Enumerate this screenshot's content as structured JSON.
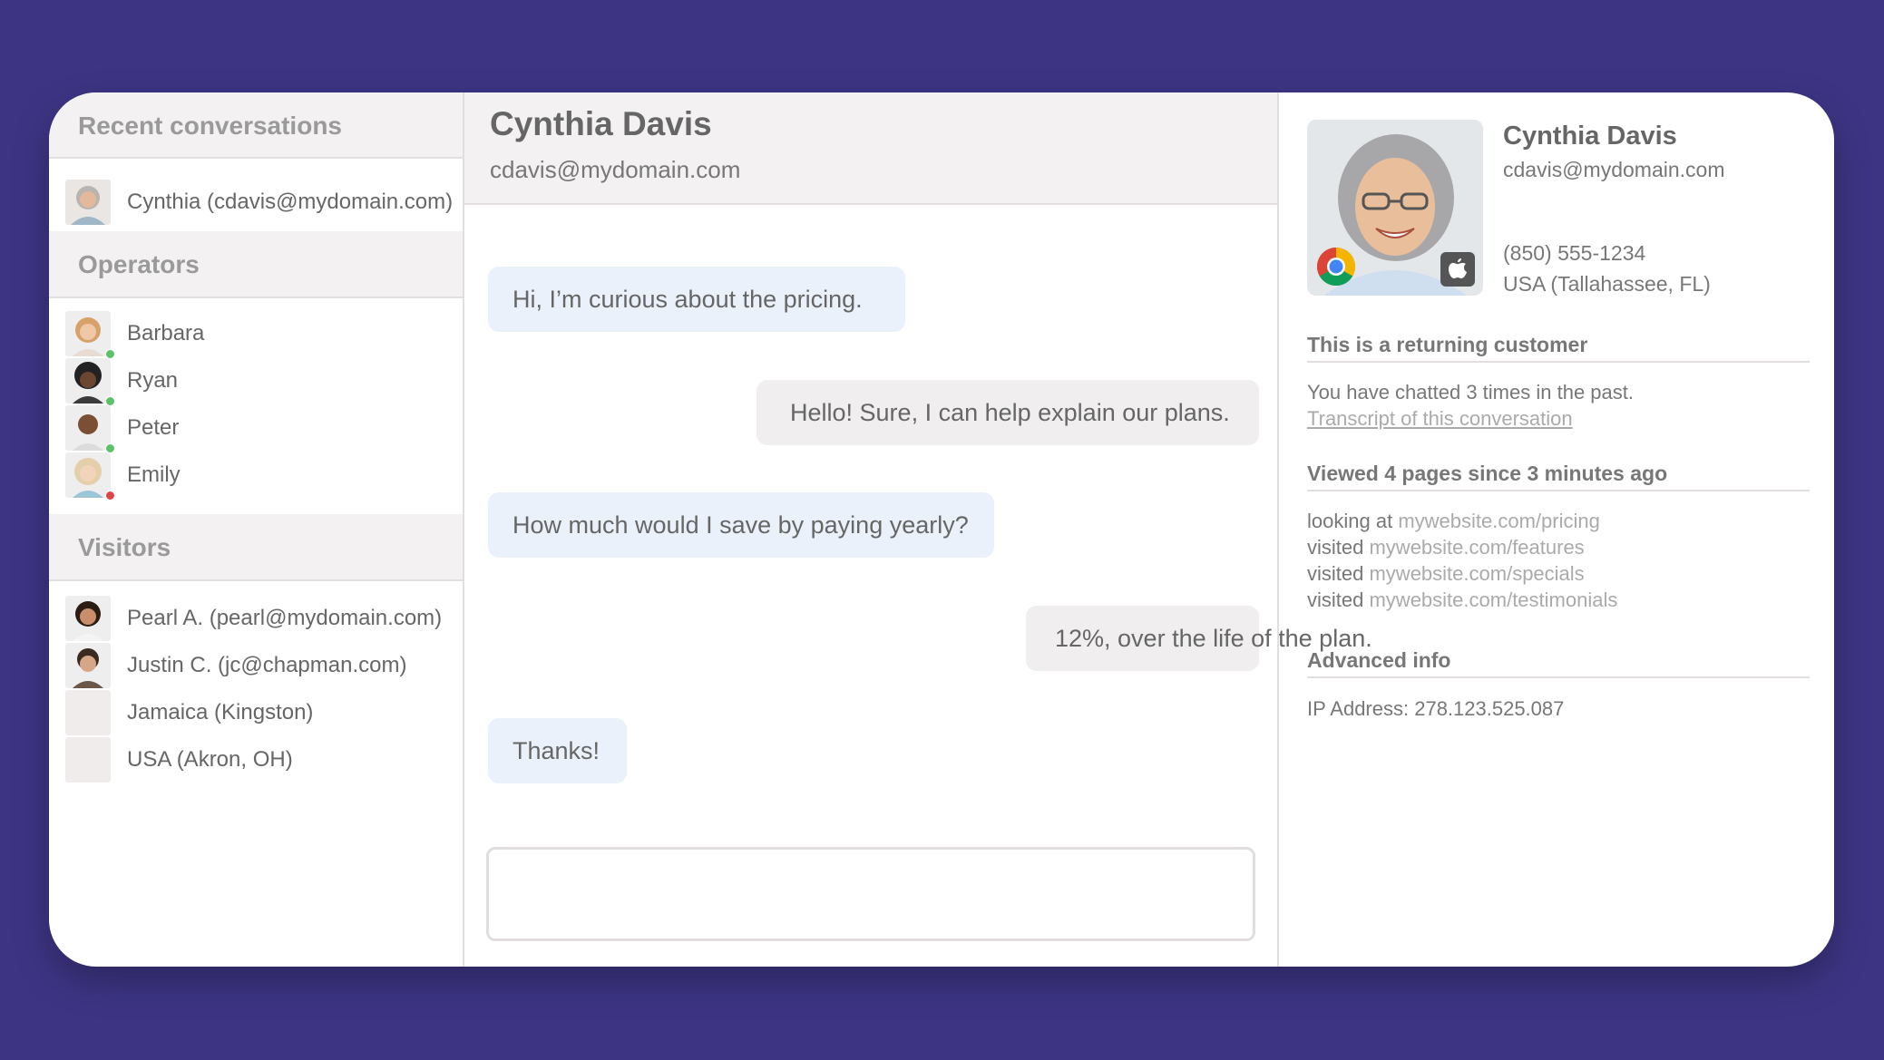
{
  "left": {
    "recent_heading": "Recent conversations",
    "recent": [
      {
        "label": "Cynthia (cdavis@mydomain.com)"
      }
    ],
    "operators_heading": "Operators",
    "operators": [
      {
        "label": "Barbara",
        "status_color": "#5cc26a"
      },
      {
        "label": "Ryan",
        "status_color": "#5cc26a"
      },
      {
        "label": "Peter",
        "status_color": "#5cc26a"
      },
      {
        "label": "Emily",
        "status_color": "#e04646"
      }
    ],
    "visitors_heading": "Visitors",
    "visitors": [
      {
        "label": "Pearl A. (pearl@mydomain.com)"
      },
      {
        "label": "Justin C. (jc@chapman.com)"
      },
      {
        "label": "Jamaica (Kingston)"
      },
      {
        "label": "USA (Akron, OH)"
      }
    ]
  },
  "chat": {
    "name": "Cynthia Davis",
    "email": "cdavis@mydomain.com",
    "messages": [
      {
        "from": "visitor",
        "text": "Hi, I’m curious about the pricing."
      },
      {
        "from": "operator",
        "text": "Hello! Sure, I can help explain our plans."
      },
      {
        "from": "visitor",
        "text": "How much would I save by paying yearly?"
      },
      {
        "from": "operator",
        "text": "12%, over the life of the plan."
      },
      {
        "from": "visitor",
        "text": "Thanks!"
      }
    ],
    "input_value": ""
  },
  "profile": {
    "name": "Cynthia Davis",
    "email": "cdavis@mydomain.com",
    "phone": "(850) 555-1234",
    "location": "USA (Tallahassee, FL)",
    "browser_icon": "chrome-icon",
    "os_icon": "apple-icon",
    "returning_heading": "This is a returning customer",
    "returning_text": "You have chatted 3 times in the past.",
    "transcript_link": "Transcript of this conversation",
    "pages_heading": "Viewed 4 pages since 3 minutes ago",
    "pages": [
      {
        "verb": "looking at",
        "url": "mywebsite.com/pricing"
      },
      {
        "verb": "visited",
        "url": "mywebsite.com/features"
      },
      {
        "verb": "visited",
        "url": "mywebsite.com/specials"
      },
      {
        "verb": "visited",
        "url": "mywebsite.com/testimonials"
      }
    ],
    "advanced_heading": "Advanced info",
    "ip_address": "IP Address: 278.123.525.087"
  },
  "colors": {
    "background": "#3d3584",
    "visitor_bubble": "#eaf1fb",
    "operator_bubble": "#f0eeee"
  }
}
